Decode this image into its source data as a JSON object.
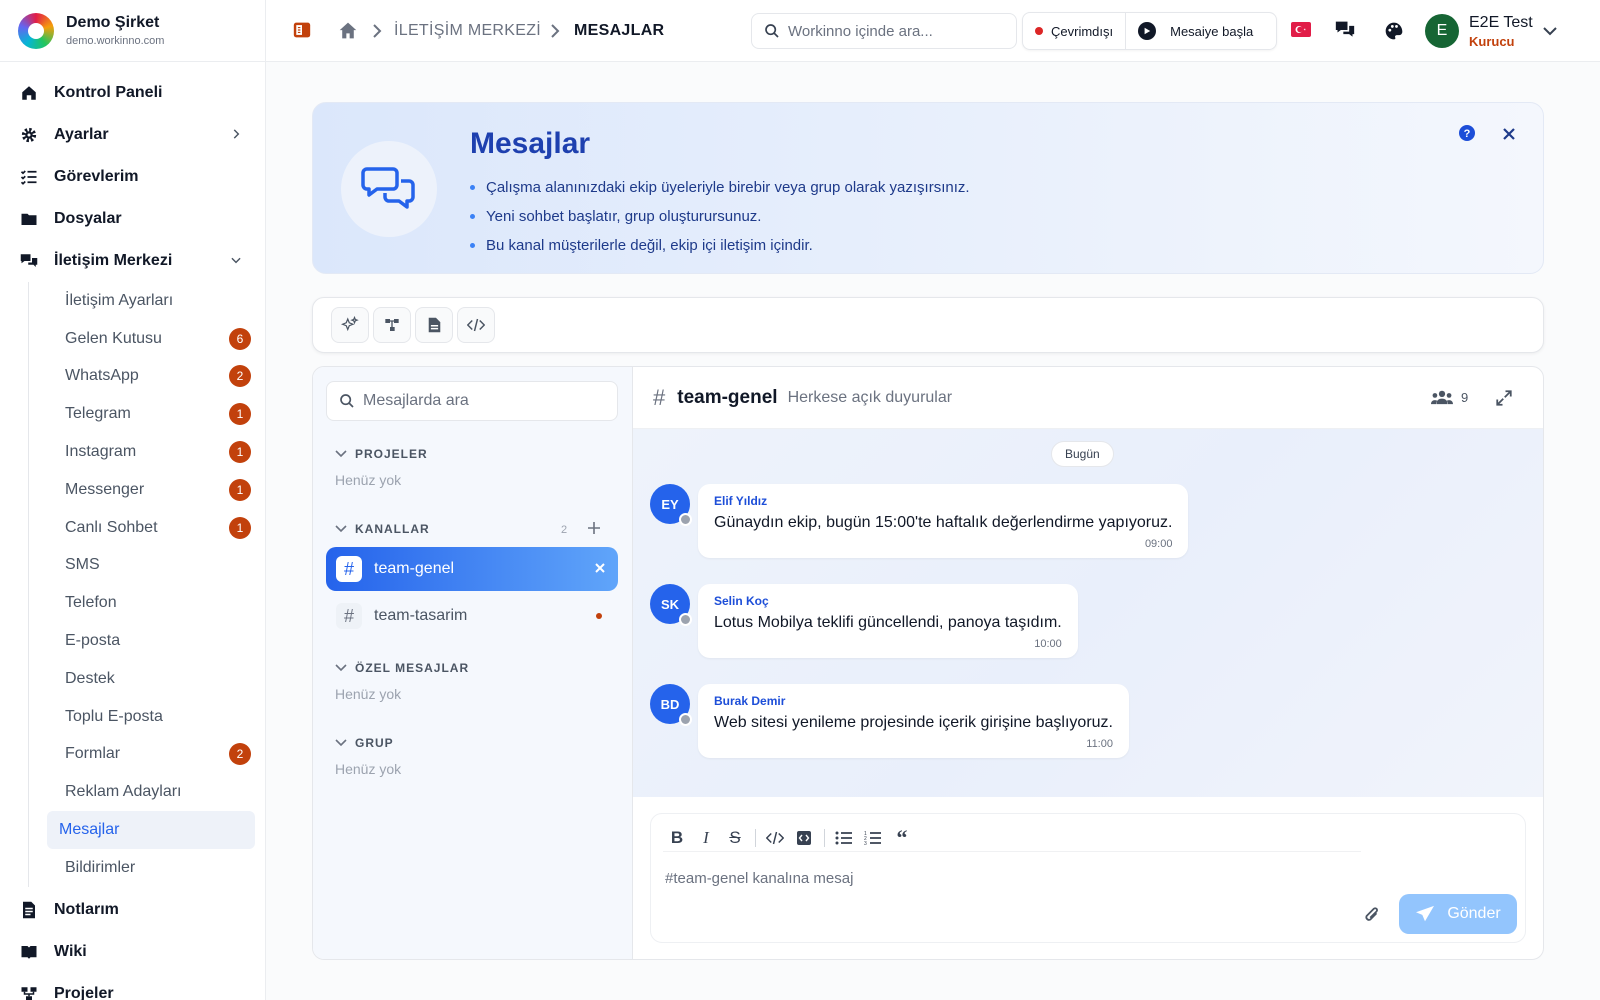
{
  "brand": {
    "name": "Demo Şirket",
    "domain": "demo.workinno.com"
  },
  "nav": {
    "dashboard": "Kontrol Paneli",
    "settings": "Ayarlar",
    "tasks": "Görevlerim",
    "files": "Dosyalar",
    "comm": "İletişim Merkezi",
    "notes": "Notlarım",
    "wiki": "Wiki",
    "projects": "Projeler"
  },
  "subnav": [
    {
      "label": "İletişim Ayarları",
      "badge": ""
    },
    {
      "label": "Gelen Kutusu",
      "badge": "6"
    },
    {
      "label": "WhatsApp",
      "badge": "2"
    },
    {
      "label": "Telegram",
      "badge": "1"
    },
    {
      "label": "Instagram",
      "badge": "1"
    },
    {
      "label": "Messenger",
      "badge": "1"
    },
    {
      "label": "Canlı Sohbet",
      "badge": "1"
    },
    {
      "label": "SMS",
      "badge": ""
    },
    {
      "label": "Telefon",
      "badge": ""
    },
    {
      "label": "E-posta",
      "badge": ""
    },
    {
      "label": "Destek",
      "badge": ""
    },
    {
      "label": "Toplu E-posta",
      "badge": ""
    },
    {
      "label": "Formlar",
      "badge": "2"
    },
    {
      "label": "Reklam Adayları",
      "badge": ""
    },
    {
      "label": "Mesajlar",
      "badge": ""
    },
    {
      "label": "Bildirimler",
      "badge": ""
    }
  ],
  "topbar": {
    "crumb1": "İLETİŞİM MERKEZİ",
    "crumb2": "MESAJLAR",
    "search_placeholder": "Workinno içinde ara...",
    "status": "Çevrimdışı",
    "start": "Mesaiye başla",
    "user_initial": "E",
    "user_name": "E2E Test",
    "user_role": "Kurucu"
  },
  "banner": {
    "title": "Mesajlar",
    "items": [
      "Çalışma alanınızdaki ekip üyeleriyle birebir veya grup olarak yazışırsınız.",
      "Yeni sohbet başlatır, grup oluşturursunuz.",
      "Bu kanal müşterilerle değil, ekip içi iletişim içindir."
    ]
  },
  "left": {
    "search_placeholder": "Mesajlarda ara",
    "projects": "PROJELER",
    "projects_empty": "Henüz yok",
    "channels": "KANALLAR",
    "channels_count": "2",
    "ch1": "team-genel",
    "ch2": "team-tasarim",
    "dm": "ÖZEL MESAJLAR",
    "dm_empty": "Henüz yok",
    "group": "GRUP",
    "group_empty": "Henüz yok"
  },
  "chat": {
    "channel": "team-genel",
    "desc": "Herkese açık duyurular",
    "members": "9",
    "date": "Bugün",
    "messages": [
      {
        "initials": "EY",
        "author": "Elif Yıldız",
        "text": "Günaydın ekip, bugün 15:00'te haftalık değerlendirme yapıyoruz.",
        "time": "09:00"
      },
      {
        "initials": "SK",
        "author": "Selin Koç",
        "text": "Lotus Mobilya teklifi güncellendi, panoya taşıdım.",
        "time": "10:00"
      },
      {
        "initials": "BD",
        "author": "Burak Demir",
        "text": "Web sitesi yenileme projesinde içerik girişine başlıyoruz.",
        "time": "11:00"
      }
    ],
    "placeholder": "#team-genel kanalına mesaj",
    "send": "Gönder"
  },
  "colors": {
    "accent": "#2563eb",
    "badge": "#c2410c",
    "status_offline": "#dc2626"
  }
}
